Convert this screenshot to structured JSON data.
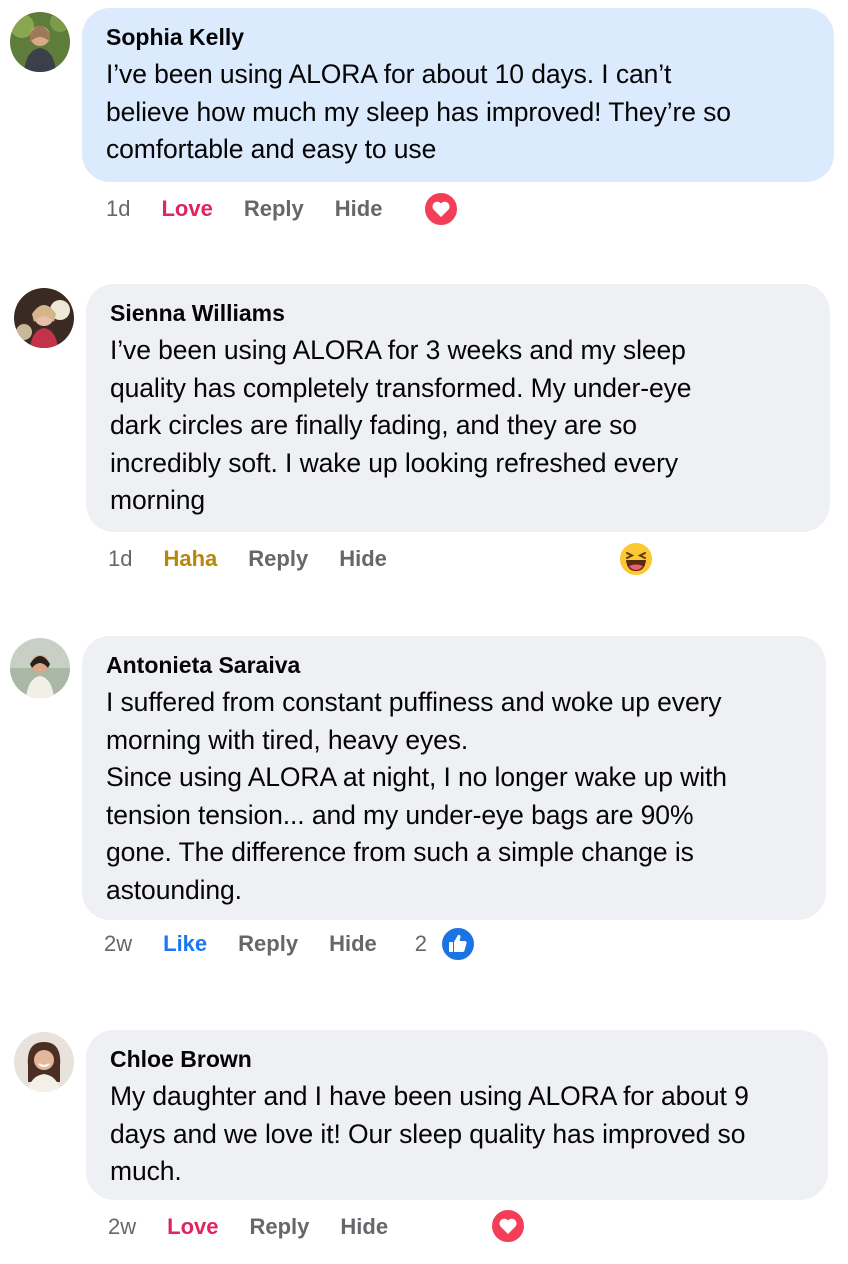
{
  "comments": [
    {
      "author": "Sophia Kelly",
      "text": "I’ve been using ALORA for about 10 days. I can’t\nbelieve how much my sleep has improved! They’re so\ncomfortable and easy to use",
      "time": "1d",
      "reaction_label": "Love",
      "reply_label": "Reply",
      "hide_label": "Hide",
      "reaction_icon": "love-icon",
      "bubble_color": "#dbeafd"
    },
    {
      "author": "Sienna Williams",
      "text": "I’ve been using ALORA for 3 weeks and my sleep\nquality has completely transformed. My under-eye\ndark circles are finally fading, and they are so\nincredibly soft. I wake up looking refreshed every\nmorning",
      "time": "1d",
      "reaction_label": "Haha",
      "reply_label": "Reply",
      "hide_label": "Hide",
      "reaction_icon": "haha-icon",
      "bubble_color": "#eff0f4"
    },
    {
      "author": "Antonieta Saraiva",
      "text": "I suffered from constant puffiness and woke up every\nmorning with tired, heavy eyes.\nSince using ALORA at night, I no longer wake up with\ntension tension... and my under-eye bags are 90%\ngone. The difference from such a simple change is\nastounding.",
      "time": "2w",
      "reaction_label": "Like",
      "reply_label": "Reply",
      "hide_label": "Hide",
      "reaction_count": "2",
      "reaction_icon": "like-icon",
      "bubble_color": "#eff0f4"
    },
    {
      "author": "Chloe Brown",
      "text": "My daughter and I have been using ALORA for about 9\ndays and we love it! Our sleep quality has improved so\nmuch.",
      "time": "2w",
      "reaction_label": "Love",
      "reply_label": "Reply",
      "hide_label": "Hide",
      "reaction_icon": "love-icon",
      "bubble_color": "#eff0f4"
    }
  ],
  "colors": {
    "love": "#e0245e",
    "haha": "#b8860b",
    "like": "#1877f2",
    "meta": "#65676b"
  }
}
